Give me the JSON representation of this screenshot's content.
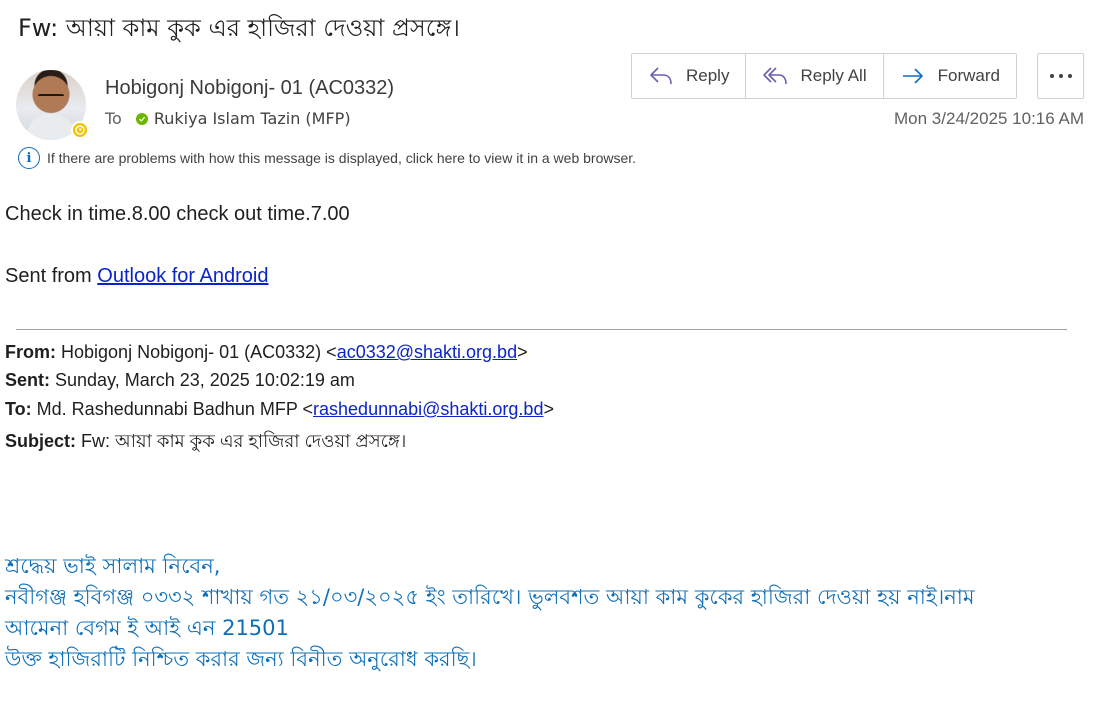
{
  "message": {
    "subject": "Fw: আয়া কাম কুক এর হাজিরা দেওয়া প্রসঙ্গে।",
    "sender": "Hobigonj Nobigonj- 01 (AC0332)",
    "to_label": "To",
    "recipient": "Rukiya Islam Tazin (MFP)",
    "timestamp": "Mon 3/24/2025 10:16 AM",
    "info_bar": "If there are problems with how this message is displayed, click here to view it in a web browser."
  },
  "actions": {
    "reply": "Reply",
    "reply_all": "Reply All",
    "forward": "Forward"
  },
  "body": {
    "line1": "Check in time.8.00 check out time.7.00",
    "sent_from_prefix": "Sent from ",
    "sent_from_link": "Outlook for Android"
  },
  "forwarded": {
    "from_label": "From:",
    "from_value": "Hobigonj Nobigonj- 01 (AC0332) <",
    "from_email": "ac0332@shakti.org.bd",
    "from_suffix": ">",
    "sent_label": "Sent:",
    "sent_value": "Sunday, March 23, 2025 10:02:19 am",
    "to_label": "To:",
    "to_value": "Md. Rashedunnabi Badhun MFP <",
    "to_email": "rashedunnabi@shakti.org.bd",
    "to_suffix": ">",
    "subject_label": "Subject:",
    "subject_value": "Fw: আয়া কাম কুক এর হাজিরা দেওয়া প্রসঙ্গে।"
  },
  "bengali_body": {
    "greeting": "শ্রদ্ধেয় ভাই সালাম নিবেন,",
    "line2": "নবীগঞ্জ হবিগঞ্জ ০৩৩২ শাখায় গত ২১/০৩/২০২৫ ইং তারিখে। ভুলবশত আয়া কাম কুকের হাজিরা দেওয়া হয় নাই।নাম",
    "line3": "আমেনা বেগম ই আই এন 21501",
    "line4": " উক্ত হাজিরাটি নিশ্চিত করার জন্য বিনীত অনুরোধ করছি।"
  },
  "colors": {
    "accent": "#0f6cbd",
    "link": "#0b24c9",
    "bengali_text": "#0e6fb8",
    "presence_away": "#f2c200",
    "presence_available": "#6bb700"
  },
  "icons": [
    "reply-icon",
    "reply-all-icon",
    "forward-icon",
    "more-icon",
    "info-icon",
    "clock-icon",
    "check-icon"
  ]
}
